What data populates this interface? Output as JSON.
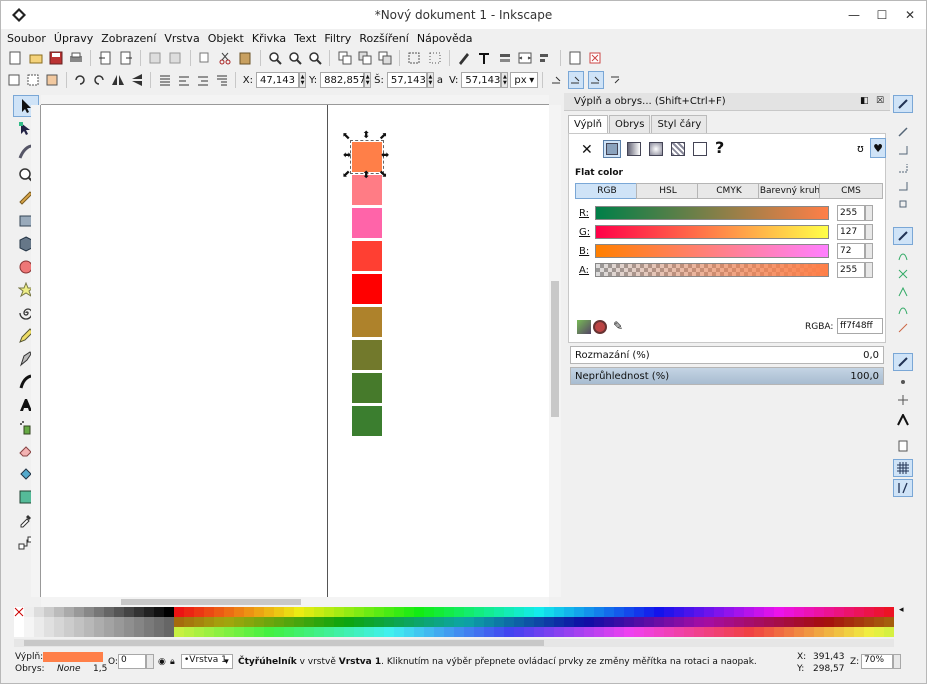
{
  "window": {
    "title": "*Nový dokument 1 - Inkscape",
    "minimize": "—",
    "maximize": "☐",
    "close": "✕"
  },
  "menu": [
    "Soubor",
    "Úpravy",
    "Zobrazení",
    "Vrstva",
    "Objekt",
    "Křivka",
    "Text",
    "Filtry",
    "Rozšíření",
    "Nápověda"
  ],
  "toolctrl": {
    "x_label": "X:",
    "x": "47,143",
    "y_label": "Y:",
    "y": "882,857",
    "w_label": "Š:",
    "w": "57,143",
    "lock": "a",
    "h_label": "V:",
    "h": "57,143",
    "unit": "px"
  },
  "swatches": [
    "#ff7f48",
    "#ff7c85",
    "#ff64a9",
    "#ff3f32",
    "#ff0000",
    "#ae822b",
    "#72792c",
    "#467a2b",
    "#3b7e2f"
  ],
  "panel": {
    "title": "Výplň a obrys... (Shift+Ctrl+F)",
    "tabs": [
      "Výplň",
      "Obrys",
      "Styl čáry"
    ],
    "flat_label": "Flat color",
    "modes": [
      "RGB",
      "HSL",
      "CMYK",
      "Barevný kruh",
      "CMS"
    ],
    "channels": [
      {
        "label": "R:",
        "value": "255"
      },
      {
        "label": "G:",
        "value": "127"
      },
      {
        "label": "B:",
        "value": "72"
      },
      {
        "label": "A:",
        "value": "255"
      }
    ],
    "rgba_label": "RGBA:",
    "rgba": "ff7f48ff",
    "blur_label": "Rozmazání (%)",
    "blur_value": "0,0",
    "opacity_label": "Neprůhlednost (%)",
    "opacity_value": "100,0"
  },
  "status": {
    "fill_label": "Výplň:",
    "stroke_label": "Obrys:",
    "stroke_value": "None",
    "stroke_width": "1,5",
    "o_label": "O:",
    "o_value": "0",
    "layer": "•Vrstva 1",
    "msg_bold": "Čtyřúhelník",
    "msg_mid": " v vrstvě ",
    "msg_layer": "Vrstva 1",
    "msg_rest": ". Kliknutím na výběr přepnete ovládací prvky ze změny měřítka na rotaci a naopak.",
    "coord_x": "391,43",
    "coord_y": "298,57",
    "x_label": "X:",
    "y_label": "Y:",
    "zoom_label": "Z:",
    "zoom": "70%"
  },
  "colors": {
    "fill": "#ff7f48",
    "accent": "#cfe3f7"
  }
}
